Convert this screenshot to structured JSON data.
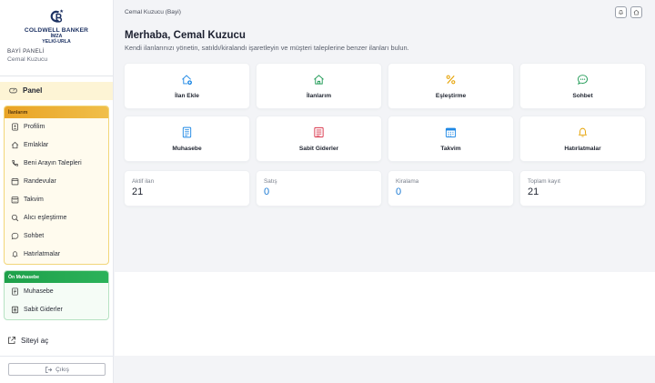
{
  "brand": {
    "name": "COLDWELL BANKER",
    "sub1": "İMZA",
    "sub2": "YELKİ-URLA"
  },
  "sidebar": {
    "panel_label": "BAYİ PANELİ",
    "user": "Cemal Kuzucu",
    "panel_nav": "Panel",
    "group1_title": "İlanlarım",
    "group1_items": [
      {
        "label": "Profilim",
        "icon": "id-card-icon"
      },
      {
        "label": "Emlaklar",
        "icon": "home-icon"
      },
      {
        "label": "Beni Arayın Talepleri",
        "icon": "phone-icon"
      },
      {
        "label": "Randevular",
        "icon": "calendar-icon"
      },
      {
        "label": "Takvim",
        "icon": "calendar-grid-icon"
      },
      {
        "label": "Alıcı eşleştirme",
        "icon": "search-icon"
      },
      {
        "label": "Sohbet",
        "icon": "chat-icon"
      },
      {
        "label": "Hatırlatmalar",
        "icon": "bell-icon"
      }
    ],
    "group2_title": "Ön Muhasebe",
    "group2_items": [
      {
        "label": "Muhasebe",
        "icon": "ledger-icon"
      },
      {
        "label": "Sabit Giderler",
        "icon": "receipt-icon"
      }
    ],
    "site_link": "Siteyi aç",
    "logout": "Çıkış"
  },
  "topbar": {
    "breadcrumb": "Cemal Kuzucu (Bayi)"
  },
  "main": {
    "greeting": "Merhaba, Cemal Kuzucu",
    "subtitle": "Kendi ilanlarınızı yönetin, satıldı/kiralandı işaretleyin ve müşteri taleplerine benzer ilanları bulun.",
    "cards": [
      {
        "label": "İlan Ekle",
        "icon": "home-add-icon",
        "color": "#1e88e5"
      },
      {
        "label": "İlanlarım",
        "icon": "home-icon",
        "color": "#1f9a55"
      },
      {
        "label": "Eşleştirme",
        "icon": "percent-icon",
        "color": "#e6a100"
      },
      {
        "label": "Sohbet",
        "icon": "chat-icon",
        "color": "#1f9a55"
      },
      {
        "label": "Muhasebe",
        "icon": "ledger-icon",
        "color": "#1e88e5"
      },
      {
        "label": "Sabit Giderler",
        "icon": "receipt-icon",
        "color": "#d9344a"
      },
      {
        "label": "Takvim",
        "icon": "calendar-grid-icon",
        "color": "#1e88e5"
      },
      {
        "label": "Hatırlatmalar",
        "icon": "bell-icon",
        "color": "#e6a100"
      }
    ],
    "stats": [
      {
        "label": "Aktif ilan",
        "value": "21"
      },
      {
        "label": "Satış",
        "value": "0"
      },
      {
        "label": "Kiralama",
        "value": "0"
      },
      {
        "label": "Toplam kayıt",
        "value": "21"
      }
    ]
  },
  "colors": {
    "accent_yellow": "#f0bf4a",
    "accent_green": "#2bb25a",
    "blue": "#1d7bd4",
    "brand_navy": "#1d3263"
  }
}
